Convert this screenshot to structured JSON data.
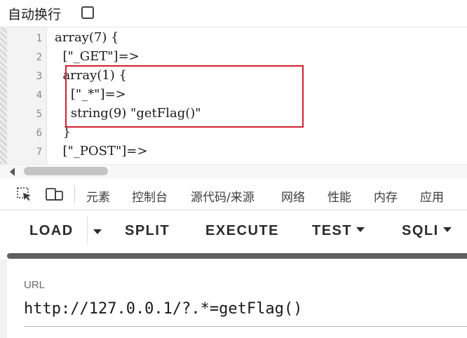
{
  "wrap_toggle": {
    "label": "自动换行",
    "checked": false
  },
  "code_viewer": {
    "lines": [
      {
        "number": "1",
        "text": "array(7) {"
      },
      {
        "number": "2",
        "text": "  [\"_GET\"]=>"
      },
      {
        "number": "3",
        "text": "  array(1) {"
      },
      {
        "number": "4",
        "text": "    [\"_*\"]=>"
      },
      {
        "number": "5",
        "text": "    string(9) \"getFlag()\""
      },
      {
        "number": "6",
        "text": "  }"
      },
      {
        "number": "7",
        "text": "  [\"_POST\"]=>"
      }
    ],
    "highlight_color": "#d0202f"
  },
  "devtools": {
    "inspect_icon": "element-picker-icon",
    "device_icon": "device-toolbar-icon",
    "tabs": [
      "元素",
      "控制台",
      "源代码/来源",
      "网络",
      "性能",
      "内存",
      "应用"
    ]
  },
  "toolbar": {
    "load_label": "LOAD",
    "split_label": "SPLIT",
    "execute_label": "EXECUTE",
    "test_label": "TEST",
    "sqli_label": "SQLI"
  },
  "url_field": {
    "label": "URL",
    "value": "http://127.0.0.1/?.*=getFlag()"
  }
}
